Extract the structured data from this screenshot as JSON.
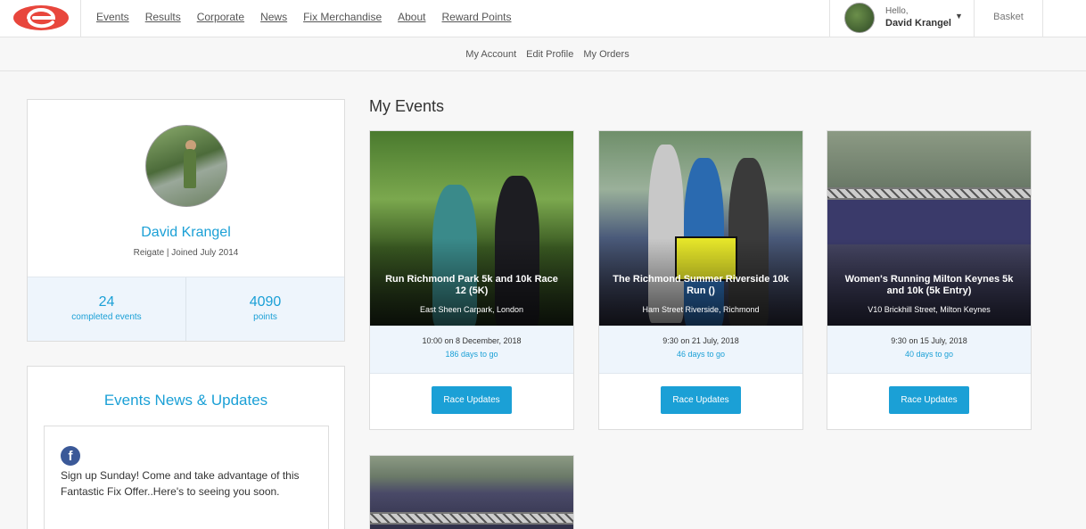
{
  "nav": {
    "items": [
      "Events",
      "Results",
      "Corporate",
      "News",
      "Fix Merchandise",
      "About",
      "Reward Points"
    ]
  },
  "user": {
    "greeting": "Hello,",
    "name": "David Krangel"
  },
  "basket": {
    "label": "Basket"
  },
  "subnav": {
    "items": [
      "My Account",
      "Edit Profile",
      "My Orders"
    ]
  },
  "profile": {
    "name": "David Krangel",
    "subtitle": "Reigate | Joined July 2014",
    "stats": [
      {
        "value": "24",
        "label": "completed events"
      },
      {
        "value": "4090",
        "label": "points"
      }
    ]
  },
  "news": {
    "title": "Events News & Updates",
    "post_text": "Sign up Sunday! Come and take advantage of this Fantastic Fix Offer..Here's to seeing you soon."
  },
  "events": {
    "title": "My Events",
    "cards": [
      {
        "title": "Run Richmond Park 5k and 10k Race 12 (5K)",
        "location": "East Sheen Carpark, London",
        "datetime": "10:00 on 8 December, 2018",
        "countdown": "186 days to go",
        "button": "Race Updates"
      },
      {
        "title": "The Richmond Summer Riverside 10k Run ()",
        "location": "Ham Street Riverside, Richmond",
        "datetime": "9:30 on 21 July, 2018",
        "countdown": "46 days to go",
        "button": "Race Updates"
      },
      {
        "title": "Women's Running Milton Keynes 5k and 10k (5k Entry)",
        "location": "V10 Brickhill Street, Milton Keynes",
        "datetime": "9:30 on 15 July, 2018",
        "countdown": "40 days to go",
        "button": "Race Updates"
      }
    ]
  },
  "colors": {
    "accent": "#1ba0d6",
    "brand_red": "#e8463c",
    "facebook": "#3b5998"
  },
  "icons": {
    "logo": "fix-logo-icon",
    "facebook": "facebook-icon",
    "dropdown": "chevron-down-icon"
  }
}
